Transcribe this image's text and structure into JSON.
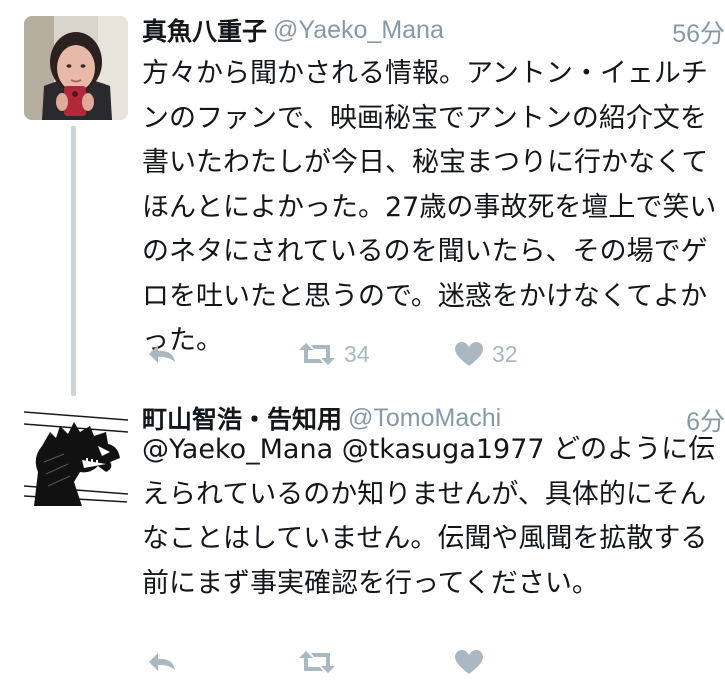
{
  "tweets": [
    {
      "display_name": "真魚八重子",
      "handle": "@Yaeko_Mana",
      "time": "56分",
      "text": "方々から聞かされる情報。アントン・イェルチンのファンで、映画秘宝でアントンの紹介文を書いたわたしが今日、秘宝まつりに行かなくてほんとによかった。27歳の事故死を壇上で笑いのネタにされているのを聞いたら、その場でゲロを吐いたと思うので。迷惑をかけなくてよかった。",
      "retweet_count": "34",
      "like_count": "32",
      "avatar_icon": "profile-photo-selfie"
    },
    {
      "display_name": "町山智浩・告知用",
      "handle": "@TomoMachi",
      "time": "6分",
      "text": "@Yaeko_Mana @tkasuga1977 どのように伝えられているのか知りませんが、具体的にそんなことはしていません。伝聞や風聞を拡散する前にまず事実確認を行ってください。",
      "retweet_count": "",
      "like_count": "",
      "avatar_icon": "kaiju-drawing"
    }
  ],
  "icons": {
    "reply": "reply-arrow-icon",
    "retweet": "retweet-icon",
    "like": "heart-icon"
  },
  "colors": {
    "name": "#14171a",
    "meta": "#8899a6",
    "action": "#aab8c2",
    "thread_line": "#c9d3dc"
  }
}
